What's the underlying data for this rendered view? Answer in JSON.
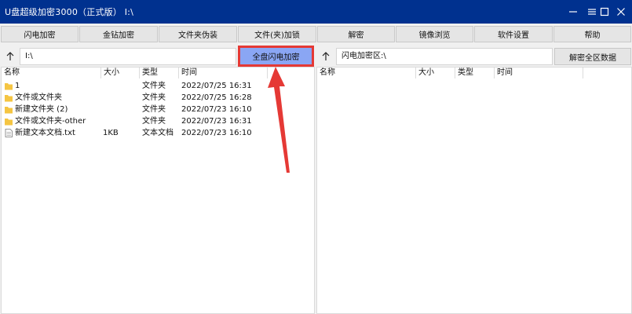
{
  "window": {
    "title": "U盘超级加密3000（正式版）  I:\\"
  },
  "toolbar": {
    "buttons": [
      {
        "label": "闪电加密"
      },
      {
        "label": "金钻加密"
      },
      {
        "label": "文件夹伪装"
      },
      {
        "label": "文件(夹)加锁"
      },
      {
        "label": "解密"
      },
      {
        "label": "镜像浏览"
      },
      {
        "label": "软件设置"
      },
      {
        "label": "帮助"
      }
    ]
  },
  "left_pane": {
    "path": "I:\\",
    "flash_button_label": "全盘闪电加密",
    "columns": [
      "名称",
      "大小",
      "类型",
      "时间"
    ],
    "rows": [
      {
        "icon": "folder-icon",
        "name": "1",
        "size": "",
        "type": "文件夹",
        "time": "2022/07/25 16:31"
      },
      {
        "icon": "folder-icon",
        "name": "文件或文件夹",
        "size": "",
        "type": "文件夹",
        "time": "2022/07/25 16:28"
      },
      {
        "icon": "folder-icon",
        "name": "新建文件夹 (2)",
        "size": "",
        "type": "文件夹",
        "time": "2022/07/23 16:10"
      },
      {
        "icon": "folder-icon",
        "name": "文件或文件夹-other",
        "size": "",
        "type": "文件夹",
        "time": "2022/07/23 16:31"
      },
      {
        "icon": "text-file-icon",
        "name": "新建文本文档.txt",
        "size": "1KB",
        "type": "文本文档",
        "time": "2022/07/23 16:10"
      }
    ]
  },
  "right_pane": {
    "path": "闪电加密区:\\",
    "decrypt_all_label": "解密全区数据",
    "columns": [
      "名称",
      "大小",
      "类型",
      "时间"
    ]
  },
  "colors": {
    "titlebar": "#00318f",
    "highlight_button": "#8aa6f4",
    "annotation_red": "#e53935",
    "folder": "#f5c542"
  }
}
